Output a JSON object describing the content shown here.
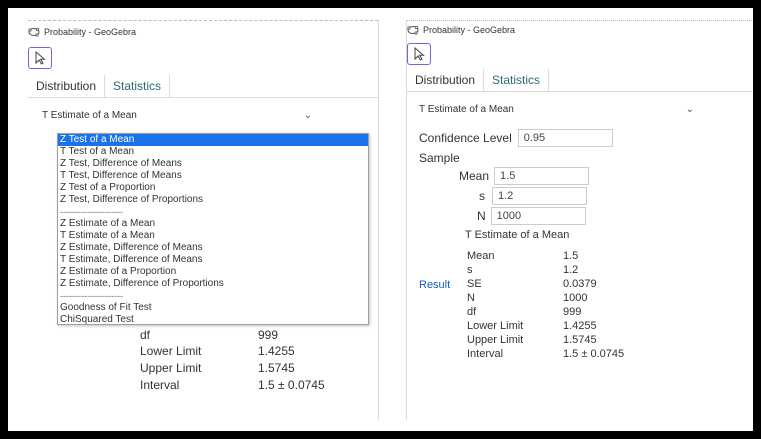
{
  "left": {
    "title": "Probability - GeoGebra",
    "tabs": [
      "Distribution",
      "Statistics"
    ],
    "select_value": "T Estimate of a Mean",
    "dropdown_options": [
      "Z Test of a Mean",
      "T Test of a Mean",
      "Z Test, Difference of Means",
      "T Test, Difference of Means",
      "Z Test of a Proportion",
      "Z Test, Difference of Proportions",
      "---------------------",
      "Z Estimate of a Mean",
      "T Estimate of a Mean",
      "Z Estimate, Difference of Means",
      "T Estimate, Difference of Means",
      "Z Estimate of a Proportion",
      "Z Estimate, Difference of Proportions",
      "---------------------",
      "Goodness of Fit Test",
      "ChiSquared Test"
    ],
    "selected_option": "Z Test of a Mean",
    "results": [
      {
        "label": "df",
        "value": "999"
      },
      {
        "label": "Lower Limit",
        "value": "1.4255"
      },
      {
        "label": "Upper Limit",
        "value": "1.5745"
      },
      {
        "label": "Interval",
        "value": "1.5 ± 0.0745"
      }
    ]
  },
  "right": {
    "title": "Probability - GeoGebra",
    "tabs": [
      "Distribution",
      "Statistics"
    ],
    "select_value": "T Estimate of a Mean",
    "confidence_label": "Confidence Level",
    "confidence_value": "0.95",
    "sample_label": "Sample",
    "mean_label": "Mean",
    "mean_value": "1.5",
    "s_label": "s",
    "s_value": "1.2",
    "n_label": "N",
    "n_value": "1000",
    "estimate_heading": "T Estimate of a Mean",
    "result_label": "Result",
    "results": [
      {
        "label": "Mean",
        "value": "1.5"
      },
      {
        "label": "s",
        "value": "1.2"
      },
      {
        "label": "SE",
        "value": "0.0379"
      },
      {
        "label": "N",
        "value": "1000"
      },
      {
        "label": "df",
        "value": "999"
      },
      {
        "label": "Lower Limit",
        "value": "1.4255"
      },
      {
        "label": "Upper Limit",
        "value": "1.5745"
      },
      {
        "label": "Interval",
        "value": "1.5 ± 0.0745"
      }
    ]
  },
  "colors": {
    "accent": "#1a73e8",
    "tab_active": "#2c6a73",
    "result_link": "#1a56c8",
    "cursor_border": "#6a6ad8"
  },
  "icons": [
    "app-logo-icon",
    "cursor-arrow-icon",
    "chevron-down-icon"
  ]
}
